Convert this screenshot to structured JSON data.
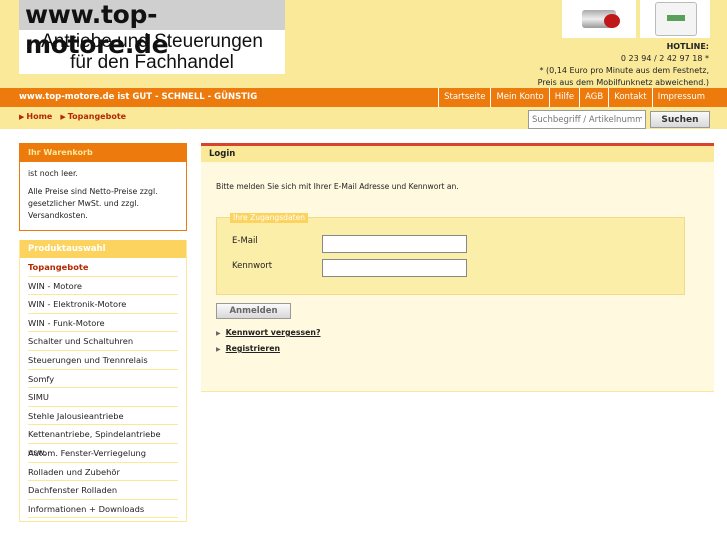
{
  "header": {
    "logo_url": "www.top-motore.de",
    "logo_line1": "Antriebe und Steuerungen",
    "logo_line2": "für den Fachhandel",
    "product_images": [
      "motor-icon",
      "switch-icon"
    ],
    "hotline_title": "HOTLINE:",
    "hotline_number": "0 23 94 / 2 42 97 18 *",
    "hotline_note1": "* (0,14 Euro pro Minute aus dem Festnetz,",
    "hotline_note2": "Preis aus dem Mobilfunknetz abweichend.)"
  },
  "navbar": {
    "slogan": "www.top-motore.de ist GUT - SCHNELL - GÜNSTIG",
    "links": [
      "Startseite",
      "Mein Konto",
      "Hilfe",
      "AGB",
      "Kontakt",
      "Impressum"
    ]
  },
  "breadcrumb": [
    "Home",
    "Topangebote"
  ],
  "search": {
    "placeholder": "Suchbegriff / Artikelnummer",
    "button": "Suchen"
  },
  "cart": {
    "title": "Ihr Warenkorb",
    "empty_text": "ist noch leer.",
    "price_note": "Alle Preise sind Netto-Preise zzgl. gesetzlicher MwSt. und zzgl.",
    "shipping_link": "Versandkosten",
    "after_link": "."
  },
  "products": {
    "title": "Produktauswahl",
    "items": [
      "Topangebote",
      "WIN - Motore",
      "WIN - Elektronik-Motore",
      "WIN - Funk-Motore",
      "Schalter und Schaltuhren",
      "Steuerungen und Trennrelais",
      "Somfy",
      "SIMU",
      "Stehle Jalousieantriebe",
      "Kettenantriebe, Spindelantriebe usw.",
      "Autom. Fenster-Verriegelung",
      "Rolladen und Zubehör",
      "Dachfenster Rolladen",
      "Informationen + Downloads"
    ]
  },
  "login": {
    "title": "Login",
    "intro": "Bitte melden Sie sich mit Ihrer E-Mail Adresse und Kennwort an.",
    "legend": "Ihre Zugangsdaten",
    "email_label": "E-Mail",
    "email_value": "",
    "password_label": "Kennwort",
    "password_value": "",
    "submit": "Anmelden",
    "forgot_link": "Kennwort vergessen?",
    "register_link": "Registrieren"
  },
  "colors": {
    "accent_orange": "#ec7a0c",
    "header_yellow": "#fbe99a",
    "link_red": "#b42a00",
    "login_border": "#d9422f"
  }
}
